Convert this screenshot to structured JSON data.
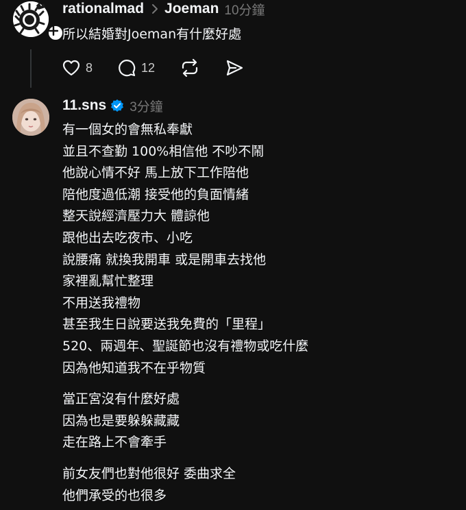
{
  "post": {
    "author": "rationalmad",
    "tag": "Joeman",
    "time": "10分鐘",
    "text": "所以結婚對Joeman有什麼好處",
    "likes": "8",
    "replies": "12"
  },
  "reply": {
    "author": "11.sns",
    "time": "3分鐘",
    "paragraphs": [
      [
        "有一個女的會無私奉獻",
        "並且不查勤 100%相信他 不吵不鬧",
        "他說心情不好 馬上放下工作陪他",
        "陪他度過低潮 接受他的負面情緒",
        "整天說經濟壓力大 體諒他",
        "跟他出去吃夜市、小吃",
        "說腰痛 就換我開車 或是開車去找他",
        "家裡亂幫忙整理",
        "不用送我禮物",
        "甚至我生日說要送我免費的「里程」",
        "520、兩週年、聖誕節也沒有禮物或吃什麼",
        "因為他知道我不在乎物質"
      ],
      [
        "當正宮沒有什麼好處",
        "因為也是要躲躲藏藏",
        "走在路上不會牽手"
      ],
      [
        "前女友們也對他很好 委曲求全",
        "他們承受的也很多"
      ]
    ]
  },
  "colors": {
    "background": "#101010",
    "text": "#f3f5f7",
    "muted": "#777777",
    "verified": "#0095f6",
    "thread_line": "#333638"
  }
}
